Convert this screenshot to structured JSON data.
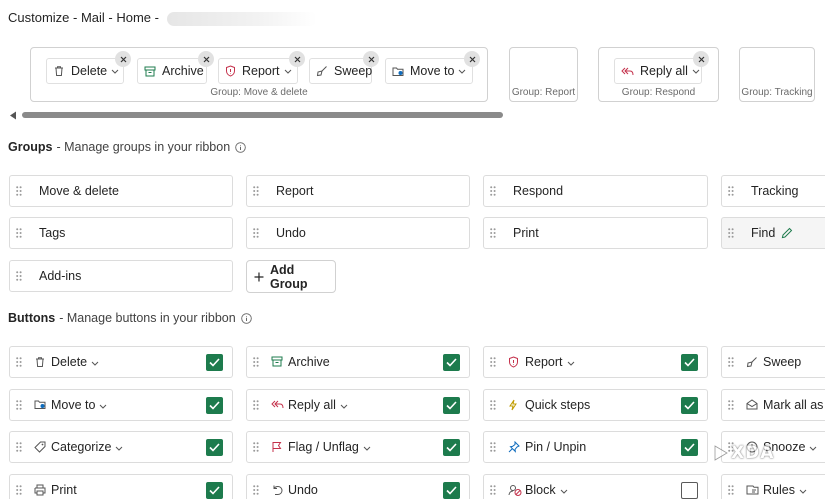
{
  "title": {
    "prefix": "Customize - Mail - Home - "
  },
  "ribbon_preview": {
    "move_delete": {
      "caption": "Group: Move & delete",
      "buttons": [
        {
          "label": "Delete",
          "icon": "trash-icon"
        },
        {
          "label": "Archive",
          "icon": "archive-icon"
        },
        {
          "label": "Report",
          "icon": "shield-icon"
        },
        {
          "label": "Sweep",
          "icon": "broom-icon"
        },
        {
          "label": "Move to",
          "icon": "folder-move-icon"
        }
      ]
    },
    "report": {
      "caption": "Group: Report"
    },
    "respond": {
      "caption": "Group: Respond",
      "buttons": [
        {
          "label": "Reply all",
          "icon": "reply-all-icon"
        }
      ]
    },
    "tracking": {
      "caption": "Group: Tracking"
    }
  },
  "groups_section": {
    "title": "Groups",
    "description": "- Manage groups in your ribbon",
    "items": [
      "Move & delete",
      "Report",
      "Respond",
      "Tracking",
      "Tags",
      "Undo",
      "Print",
      "Find",
      "Add-ins"
    ],
    "add_group_label": "Add Group"
  },
  "buttons_section": {
    "title": "Buttons",
    "description": "- Manage buttons in your ribbon",
    "items": [
      {
        "label": "Delete",
        "dropdown": true,
        "checked": true,
        "icon": "trash-icon"
      },
      {
        "label": "Archive",
        "dropdown": false,
        "checked": true,
        "icon": "archive-icon"
      },
      {
        "label": "Report",
        "dropdown": true,
        "checked": true,
        "icon": "shield-icon"
      },
      {
        "label": "Sweep",
        "dropdown": false,
        "icon": "broom-icon"
      },
      {
        "label": "Move to",
        "dropdown": true,
        "checked": true,
        "icon": "folder-move-icon"
      },
      {
        "label": "Reply all",
        "dropdown": true,
        "checked": true,
        "icon": "reply-all-icon"
      },
      {
        "label": "Quick steps",
        "dropdown": false,
        "checked": true,
        "icon": "lightning-icon"
      },
      {
        "label": "Mark all as r",
        "dropdown": false,
        "icon": "envelope-open-icon"
      },
      {
        "label": "Categorize",
        "dropdown": true,
        "checked": true,
        "icon": "tag-icon"
      },
      {
        "label": "Flag / Unflag",
        "dropdown": true,
        "checked": true,
        "icon": "flag-icon"
      },
      {
        "label": "Pin / Unpin",
        "dropdown": false,
        "checked": true,
        "icon": "pin-icon"
      },
      {
        "label": "Snooze",
        "dropdown": true,
        "icon": "clock-icon"
      },
      {
        "label": "Print",
        "dropdown": false,
        "checked": true,
        "icon": "printer-icon"
      },
      {
        "label": "Undo",
        "dropdown": false,
        "checked": true,
        "icon": "undo-icon"
      },
      {
        "label": "Block",
        "dropdown": true,
        "checked": false,
        "icon": "block-icon"
      },
      {
        "label": "Rules",
        "dropdown": true,
        "icon": "rules-icon"
      }
    ]
  },
  "watermark": "XDA",
  "colors": {
    "check_green": "#1d7b4d",
    "flag_red": "#c4314b",
    "report_red": "#c4314b",
    "pin_blue": "#0f6cbd",
    "quick_steps_yellow": "#c19c00"
  }
}
